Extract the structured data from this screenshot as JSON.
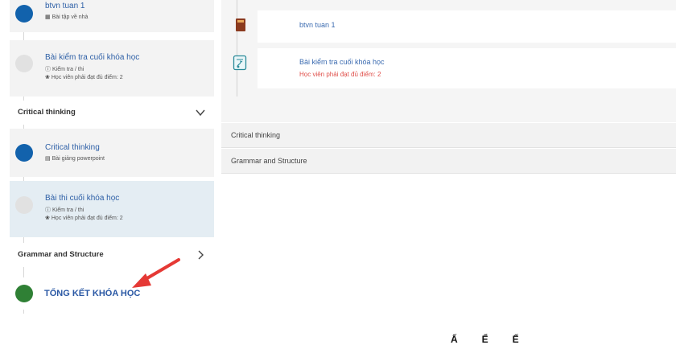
{
  "sidebar": {
    "lessons_top": [
      {
        "title": "btvn tuan 1",
        "subtitle": "Bài tập về nhà",
        "icon": "homework-icon",
        "dot": "blue"
      },
      {
        "title": "Bài kiểm tra cuối khóa học",
        "subtitle": "Kiểm tra / thi",
        "note": "Học viên phải đạt đủ điểm: 2",
        "icon": "quiz-icon",
        "dot": "grey"
      }
    ],
    "sections": [
      {
        "title": "Critical thinking",
        "state": "expanded"
      },
      {
        "title": "Grammar and Structure",
        "state": "collapsed"
      }
    ],
    "critical_thinking_lessons": [
      {
        "title": "Critical thinking",
        "subtitle": "Bài giảng powerpoint",
        "icon": "slides-icon",
        "dot": "blue"
      },
      {
        "title": "Bài thi cuối khóa học",
        "subtitle": "Kiểm tra / thi",
        "note": "Học viên phải đạt đủ điểm: 2",
        "icon": "quiz-icon",
        "dot": "grey"
      }
    ],
    "final": {
      "title": "TỔNG KẾT KHÓA HỌC",
      "dot": "green"
    }
  },
  "content": {
    "items": [
      {
        "title": "btvn tuan 1",
        "icon": "book-icon"
      },
      {
        "title": "Bài kiểm tra cuối khóa học",
        "note": "Học viên phải đạt đủ điểm: 2",
        "icon": "document-icon"
      }
    ],
    "accordions": [
      "Critical thinking",
      "Grammar and Structure"
    ]
  },
  "caption": "ẤỂẾ",
  "colors": {
    "accent_blue": "#1262ac",
    "green": "#2f8035",
    "warning_red": "#e0504b",
    "arrow_red": "#e53935"
  }
}
